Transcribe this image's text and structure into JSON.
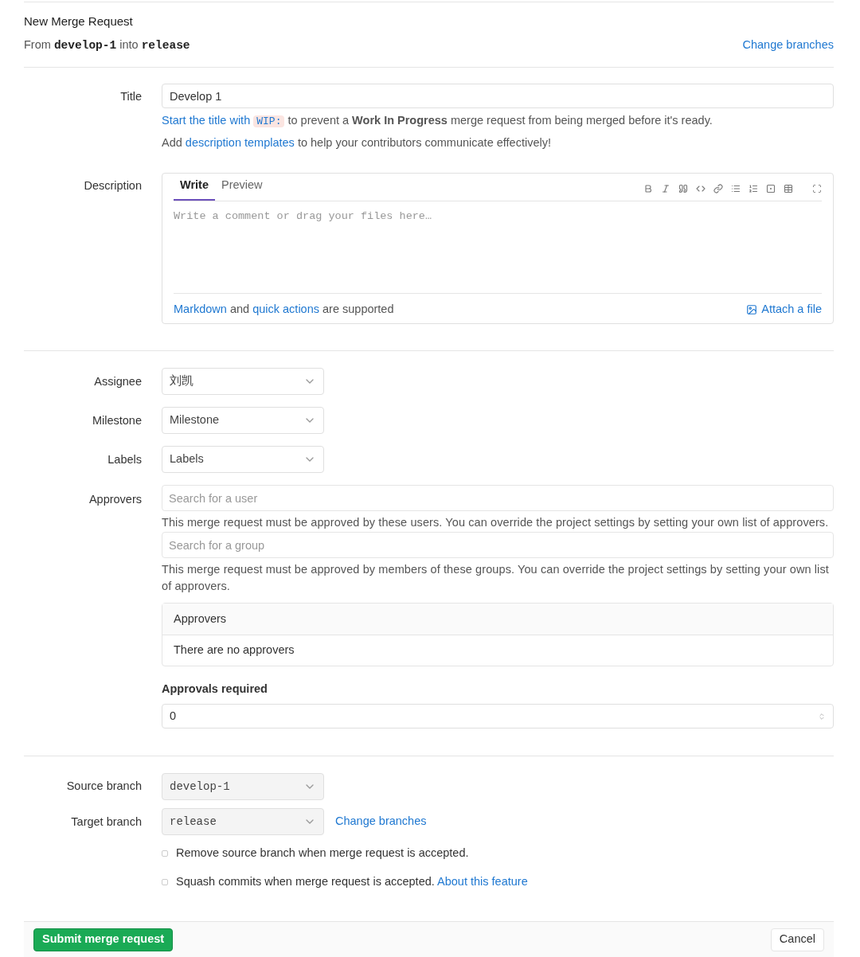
{
  "header": {
    "title": "New Merge Request",
    "from": [
      {
        "kind": "text",
        "text": "From"
      },
      {
        "kind": "branch",
        "text": "develop-1"
      },
      {
        "kind": "text",
        "text": "into"
      },
      {
        "kind": "branch",
        "text": "release"
      }
    ],
    "change_link": "Change branches"
  },
  "title_field": {
    "label": "Title",
    "value": "Develop 1",
    "hints": [
      [
        {
          "kind": "link",
          "text": "Start the title with"
        },
        {
          "kind": "code",
          "text": "WIP:"
        },
        {
          "kind": "text",
          "text": "to prevent a **Work In Progress** merge request from being merged before it's ready."
        }
      ],
      [
        {
          "kind": "text",
          "text": "Add"
        },
        {
          "kind": "link",
          "text": "description templates"
        },
        {
          "kind": "text",
          "text": "to help your contributors communicate effectively!"
        }
      ]
    ]
  },
  "description": {
    "label": "Description",
    "tabs": [
      {
        "label": "Write",
        "selected": true
      },
      {
        "label": "Preview",
        "selected": false
      }
    ],
    "placeholder": "Write a comment or drag your files here…",
    "footer": [
      {
        "kind": "link",
        "text": "Markdown"
      },
      {
        "kind": "text",
        "text": "and"
      },
      {
        "kind": "link",
        "text": "quick actions"
      },
      {
        "kind": "text",
        "text": "are supported"
      }
    ],
    "attach": "Attach a file"
  },
  "selects": [
    {
      "label": "Assignee",
      "value": "刘凯"
    },
    {
      "label": "Milestone",
      "value": "Milestone"
    },
    {
      "label": "Labels",
      "value": "Labels"
    }
  ],
  "approvers": {
    "label": "Approvers",
    "user_placeholder": "Search for a user",
    "user_help": "This merge request must be approved by these users. You can override the project settings by setting your own list of approvers.",
    "group_placeholder": "Search for a group",
    "group_help": "This merge request must be approved by members of these groups. You can override the project settings by setting your own list of approvers.",
    "table_heading": "Approvers",
    "table_empty": "There are no approvers",
    "required_label": "Approvals required",
    "required_value": "0"
  },
  "branches": {
    "source_label": "Source branch",
    "source": "develop-1",
    "target_label": "Target branch",
    "target": "release",
    "change_link": "Change branches"
  },
  "options": [
    {
      "label": "Remove source branch when merge request is accepted.",
      "checked": false
    },
    {
      "label": "Squash commits when merge request is accepted.",
      "checked": false,
      "link": "About this feature"
    }
  ],
  "actions": {
    "submit": "Submit merge request",
    "cancel": "Cancel"
  }
}
